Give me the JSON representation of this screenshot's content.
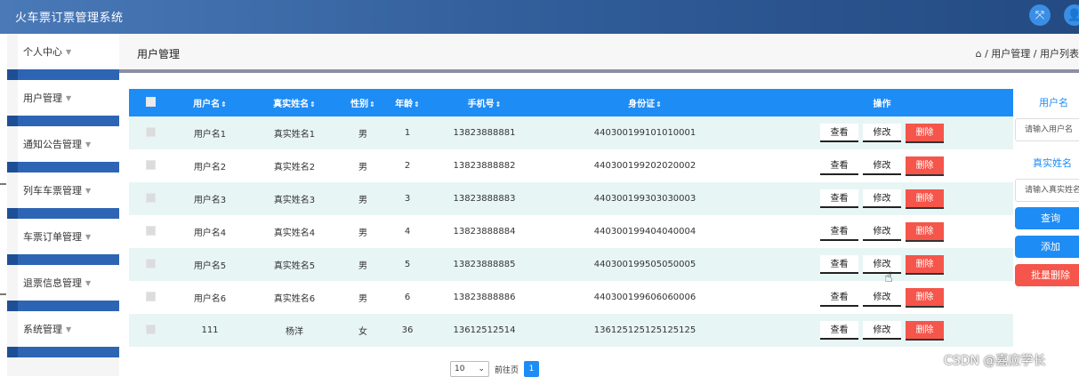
{
  "app": {
    "title": "火车票订票管理系统"
  },
  "topbar": {
    "icons": [
      "expand-icon",
      "user-icon"
    ],
    "expand_glyph": "⤧",
    "user_glyph": "👤"
  },
  "sidebar": {
    "items": [
      {
        "label": "个人中心"
      },
      {
        "label": "用户管理"
      },
      {
        "label": "通知公告管理"
      },
      {
        "label": "列车车票管理"
      },
      {
        "label": "车票订单管理"
      },
      {
        "label": "退票信息管理"
      },
      {
        "label": "系统管理"
      }
    ],
    "arrow": "▼"
  },
  "header": {
    "page_title": "用户管理",
    "breadcrumb": "⌂ / 用户管理 / 用户列表"
  },
  "table": {
    "columns": {
      "username": "用户名",
      "realname": "真实姓名",
      "gender": "性别",
      "age": "年龄",
      "phone": "手机号",
      "idcard": "身份证",
      "actions": "操作",
      "sort": "⇕"
    },
    "buttons": {
      "view": "查看",
      "edit": "修改",
      "delete": "删除"
    },
    "rows": [
      {
        "username": "用户名1",
        "realname": "真实姓名1",
        "gender": "男",
        "age": "1",
        "phone": "13823888881",
        "idcard": "440300199101010001"
      },
      {
        "username": "用户名2",
        "realname": "真实姓名2",
        "gender": "男",
        "age": "2",
        "phone": "13823888882",
        "idcard": "440300199202020002"
      },
      {
        "username": "用户名3",
        "realname": "真实姓名3",
        "gender": "男",
        "age": "3",
        "phone": "13823888883",
        "idcard": "440300199303030003"
      },
      {
        "username": "用户名4",
        "realname": "真实姓名4",
        "gender": "男",
        "age": "4",
        "phone": "13823888884",
        "idcard": "440300199404040004"
      },
      {
        "username": "用户名5",
        "realname": "真实姓名5",
        "gender": "男",
        "age": "5",
        "phone": "13823888885",
        "idcard": "440300199505050005"
      },
      {
        "username": "用户名6",
        "realname": "真实姓名6",
        "gender": "男",
        "age": "6",
        "phone": "13823888886",
        "idcard": "440300199606060006"
      },
      {
        "username": "111",
        "realname": "杨洋",
        "gender": "女",
        "age": "36",
        "phone": "13612512514",
        "idcard": "136125125125125125"
      }
    ]
  },
  "pagination": {
    "page_size": "10",
    "goto_label": "前往页",
    "current_page": "1",
    "chevron": "⌄"
  },
  "search": {
    "username_label": "用户名",
    "username_placeholder": "请输入用户名",
    "realname_label": "真实姓名",
    "realname_placeholder": "请输入真实姓名",
    "query_button": "查询",
    "add_button": "添加",
    "batch_delete_button": "批量删除"
  },
  "colors": {
    "primary": "#1e8cf5",
    "danger": "#f5554a",
    "header_bar": "#2f5b97",
    "row_stripe": "#e8f5f5"
  },
  "watermark": "CSDN @嘉应学长"
}
